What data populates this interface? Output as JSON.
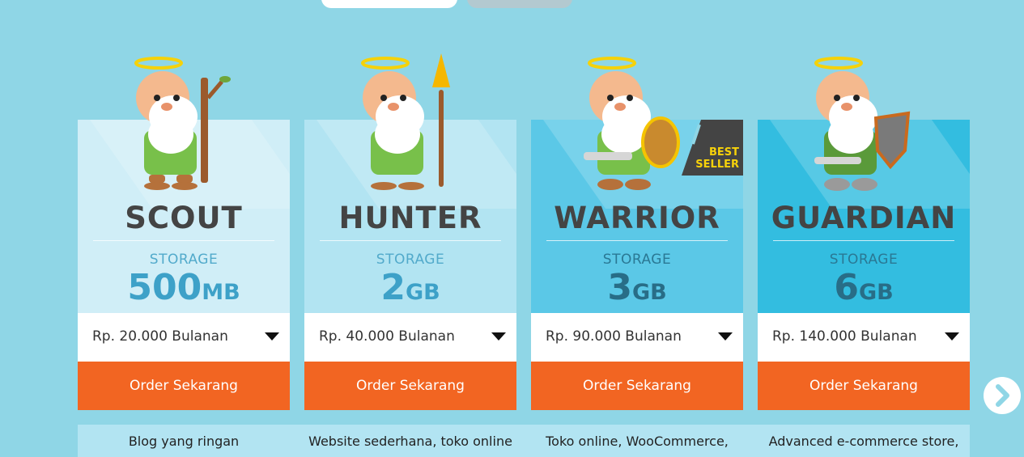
{
  "plans": [
    {
      "name": "SCOUT",
      "storage_label": "STORAGE",
      "storage_num": "500",
      "storage_unit": "MB",
      "price": "Rp. 20.000 Bulanan",
      "order_label": "Order Sekarang",
      "description": "Blog yang ringan"
    },
    {
      "name": "HUNTER",
      "storage_label": "STORAGE",
      "storage_num": "2",
      "storage_unit": "GB",
      "price": "Rp. 40.000 Bulanan",
      "order_label": "Order Sekarang",
      "description": "Website sederhana, toko online"
    },
    {
      "name": "WARRIOR",
      "storage_label": "STORAGE",
      "storage_num": "3",
      "storage_unit": "GB",
      "price": "Rp. 90.000 Bulanan",
      "order_label": "Order Sekarang",
      "description": "Toko online, WooCommerce,",
      "badge_line1": "BEST",
      "badge_line2": "SELLER"
    },
    {
      "name": "GUARDIAN",
      "storage_label": "STORAGE",
      "storage_num": "6",
      "storage_unit": "GB",
      "price": "Rp. 140.000 Bulanan",
      "order_label": "Order Sekarang",
      "description": "Advanced e-commerce store,"
    }
  ],
  "icons": {
    "mascots": [
      "scout-mascot-icon",
      "hunter-mascot-icon",
      "warrior-mascot-icon",
      "guardian-mascot-icon"
    ],
    "dropdown": "caret-down-icon",
    "next": "chevron-right-icon"
  },
  "colors": {
    "accent": "#f26522",
    "background": "#8fd6e6",
    "badge": "#f7d20a"
  }
}
